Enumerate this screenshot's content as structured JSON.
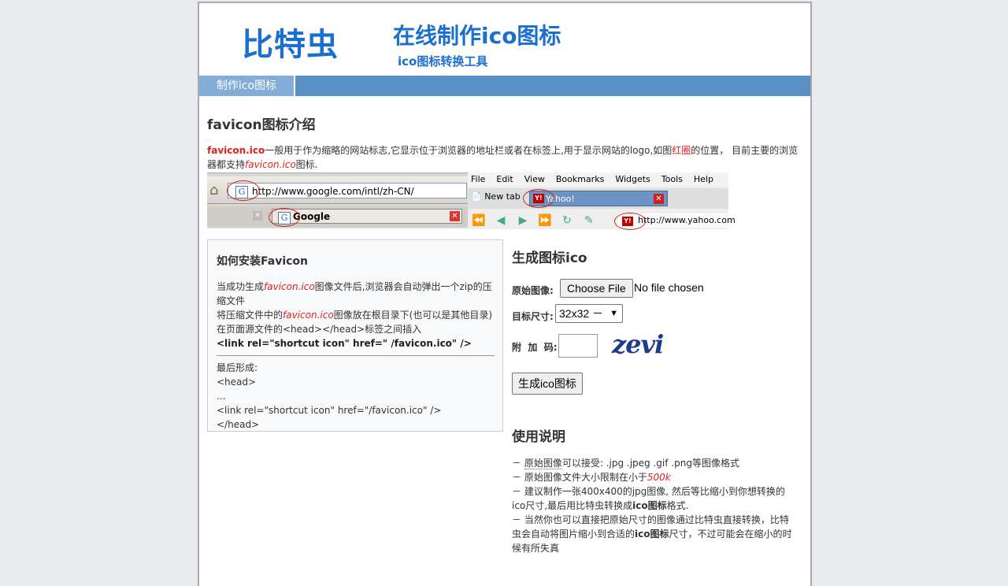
{
  "header": {
    "logo": "比特虫",
    "title": "在线制作ico图标",
    "subtitle": "ico图标转换工具"
  },
  "nav": {
    "tab": "制作ico图标"
  },
  "intro": {
    "heading": "favicon图标介绍",
    "p_part1": "favicon.ico",
    "p_part2": "一般用于作为缩略的网站标志,它显示位于浏览器的地址栏或者在标签上,用于显示网站的logo,如图",
    "p_part3": "红圈",
    "p_part4": "的位置，  目前主要的浏览器都支持",
    "p_part5": "favicon.ico",
    "p_part6": "图标."
  },
  "illustration": {
    "url_google": "http://www.google.com/intl/zh-CN/",
    "tab_google": "Google",
    "menu": [
      "File",
      "Edit",
      "View",
      "Bookmarks",
      "Widgets",
      "Tools",
      "Help"
    ],
    "new_tab": "New tab",
    "tab_yahoo": "Yahoo!",
    "url_yahoo": "http://www.yahoo.com"
  },
  "install": {
    "heading": "如何安装Favicon",
    "line1a": "当成功生成",
    "line1b": "favicon.ico",
    "line1c": "图像文件后,浏览器会自动弹出一个zip的压缩文件",
    "line2a": "将压缩文件中的",
    "line2b": "favicon.ico",
    "line2c": "图像放在根目录下(也可以是其他目录)",
    "line3": "在页面源文件的<head></head>标签之间插入",
    "line4": "<link rel=\"shortcut icon\" href=\" /favicon.ico\" />",
    "final_label": "最后形成:",
    "final1": "<head>",
    "final2": "...",
    "final3": "<link rel=\"shortcut icon\" href=\"/favicon.ico\" />",
    "final4": "</head>"
  },
  "form": {
    "heading": "生成图标ico",
    "source_label": "原始图像:",
    "choose_file": "Choose File",
    "no_file": "No file chosen",
    "size_label": "目标尺寸:",
    "size_value": "32x32 －",
    "code_label": "附  加  码:",
    "captcha": "zevi",
    "submit": "生成ico图标"
  },
  "usage": {
    "heading": "使用说明",
    "l1a": "－ ",
    "l1b": "原始图像",
    "l1c": "可以接受: .jpg .jpeg .gif .png等图像格式",
    "l2a": "－ 原始图像文件大小限制在小于",
    "l2b": "500k",
    "l3a": "－ 建议制作一张400x400的jpg图像, 然后等比缩小到你想转换的ico尺寸,最后用比特虫转换成",
    "l3b": "ico图标",
    "l3c": "格式.",
    "l4a": "－ 当然你也可以直接把原始尺寸的图像通过比特虫直接转换，比特虫会自动将图片缩小到合适的",
    "l4b": "ico图标",
    "l4c": "尺寸，不过可能会在缩小的时候有所失真"
  }
}
